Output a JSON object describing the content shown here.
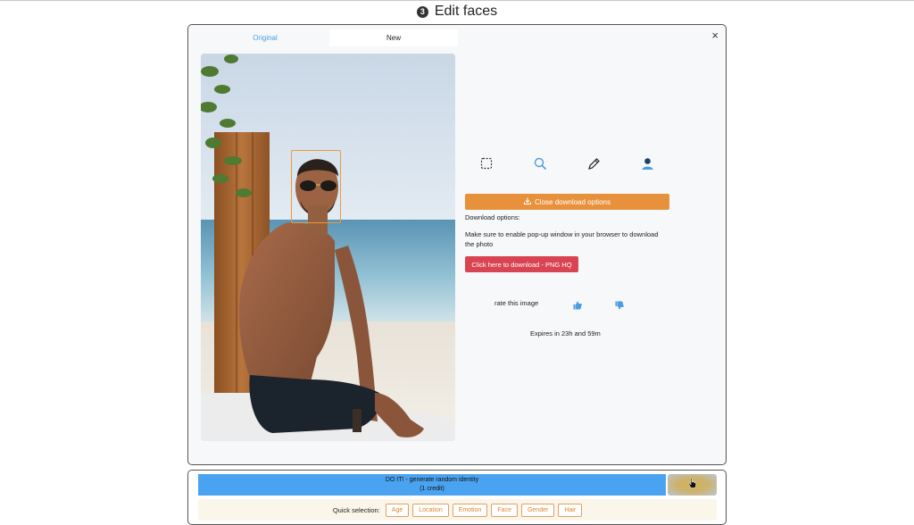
{
  "header": {
    "step_number": "3",
    "title": "Edit faces"
  },
  "modal": {
    "close_symbol": "×",
    "tabs": [
      {
        "label": "Original"
      },
      {
        "label": "New"
      }
    ],
    "tools": [
      {
        "icon": "selection-icon"
      },
      {
        "icon": "search-icon"
      },
      {
        "icon": "pencil-icon"
      },
      {
        "icon": "user-icon"
      }
    ],
    "close_download_label": "Close download options",
    "download_options_label": "Download options:",
    "popup_notice_line1": "Make sure to enable pop-up window in your browser to download",
    "popup_notice_line2": "the photo",
    "download_png_label": "Click here to download - PNG HQ",
    "rate_label": "rate this image",
    "expires_text": "Expires in 23h and 59m"
  },
  "actions": {
    "doit_line1": "DO IT! - generate random identity",
    "doit_line2": "(1 credit)",
    "quick_selection_label": "Quick selection:",
    "quick_options": [
      "Age",
      "Location",
      "Emotion",
      "Face",
      "Gender",
      "Hair"
    ]
  },
  "colors": {
    "accent_blue": "#4aa3f0",
    "orange": "#e8913c",
    "red": "#d94452",
    "tab_active_text": "#4a9de0"
  }
}
